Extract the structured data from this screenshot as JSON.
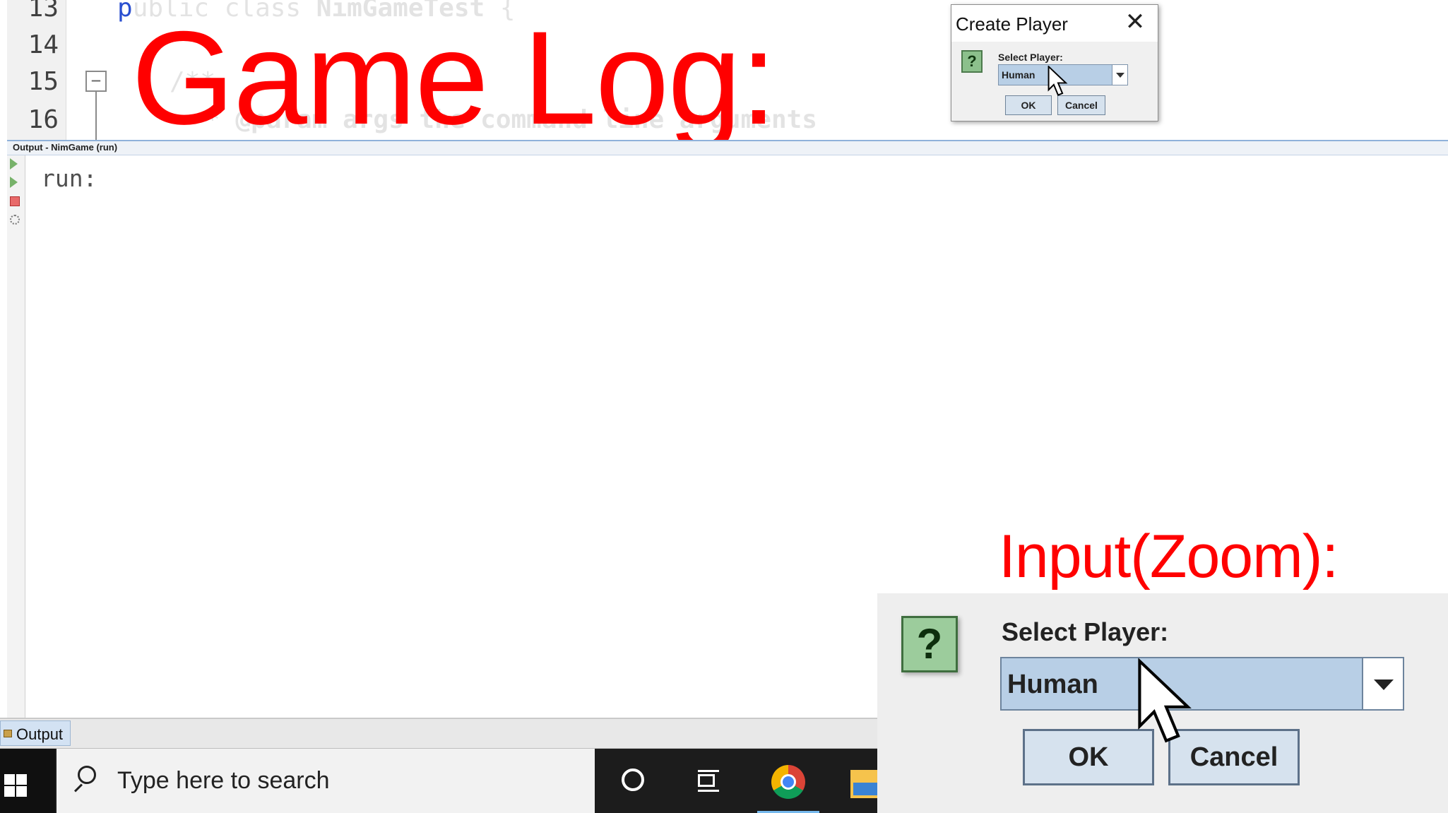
{
  "editor": {
    "line_numbers": [
      "13",
      "14",
      "15",
      "16"
    ],
    "code": {
      "line_13_cursor": "p",
      "line_13_rest": "ublic class ",
      "line_13_classname": "NimGameTest",
      "line_13_brace": " {",
      "line_15": "/**",
      "line_16_prefix": "* ",
      "line_16_rest": "@param args the command line arguments"
    },
    "fold_symbol": "−"
  },
  "overlay": {
    "game_log_title": "Game Log:",
    "zoom_title": "Input(Zoom):",
    "color": "#ff0000"
  },
  "dialog": {
    "title": "Create Player",
    "close_glyph": "✕",
    "question_icon": "?",
    "label": "Select Player:",
    "selected_value": "Human",
    "ok_label": "OK",
    "cancel_label": "Cancel"
  },
  "output": {
    "header_label": "Output - NimGame (run)",
    "text": "run:",
    "tab_label": "Output"
  },
  "taskbar": {
    "search_placeholder": "Type here to search",
    "icons": [
      "windows-start-icon",
      "search-icon",
      "cortana-icon",
      "task-view-icon",
      "chrome-icon",
      "file-explorer-icon"
    ]
  },
  "zoom": {
    "question_icon": "?",
    "label": "Select Player:",
    "selected_value": "Human",
    "ok_label": "OK",
    "cancel_label": "Cancel"
  },
  "colors": {
    "combo_fill": "#b8cfe6",
    "button_fill": "#d6e2ee",
    "question_icon_fill": "#9ccc9c",
    "taskbar": "#1c1c1c"
  }
}
